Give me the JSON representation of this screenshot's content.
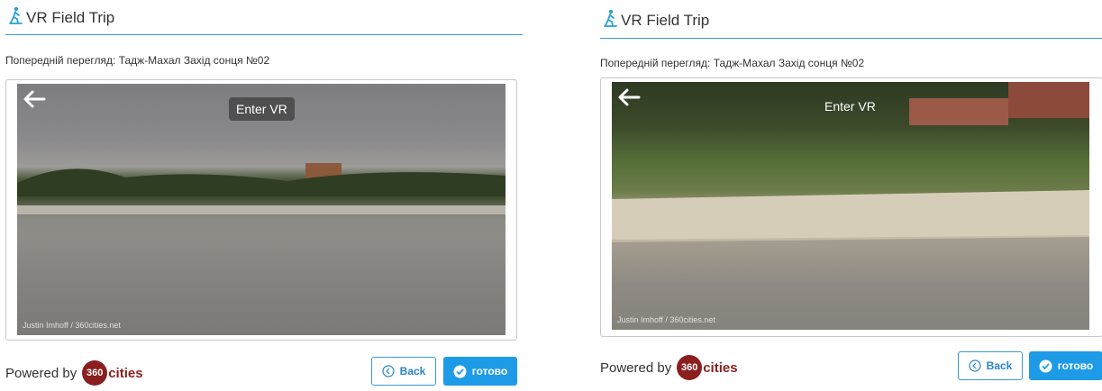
{
  "panels": [
    {
      "header": {
        "title": "VR Field Trip"
      },
      "preview_label": "Попередній перегляд: Тадж-Махал Захід сонця №02",
      "viewer": {
        "enter_vr": "Enter VR",
        "credit": "Justin Imhoff / 360cities.net"
      },
      "footer": {
        "powered_by": "Powered by",
        "logo_number": "360",
        "logo_text": "cities",
        "back_label": "Back",
        "done_label": "готово"
      }
    },
    {
      "header": {
        "title": "VR Field Trip"
      },
      "preview_label": "Попередній перегляд: Тадж-Махал Захід сонця №02",
      "viewer": {
        "enter_vr": "Enter VR",
        "credit": "Justin Imhoff / 360cities.net"
      },
      "footer": {
        "powered_by": "Powered by",
        "logo_number": "360",
        "logo_text": "cities",
        "back_label": "Back",
        "done_label": "готово"
      }
    }
  ],
  "colors": {
    "accent": "#1e9be6",
    "rule": "#3a9ad9",
    "logo": "#8b1f1f"
  },
  "icons": [
    "hiker-icon",
    "arrow-left-icon",
    "chevron-left-circle-icon",
    "check-circle-icon"
  ]
}
